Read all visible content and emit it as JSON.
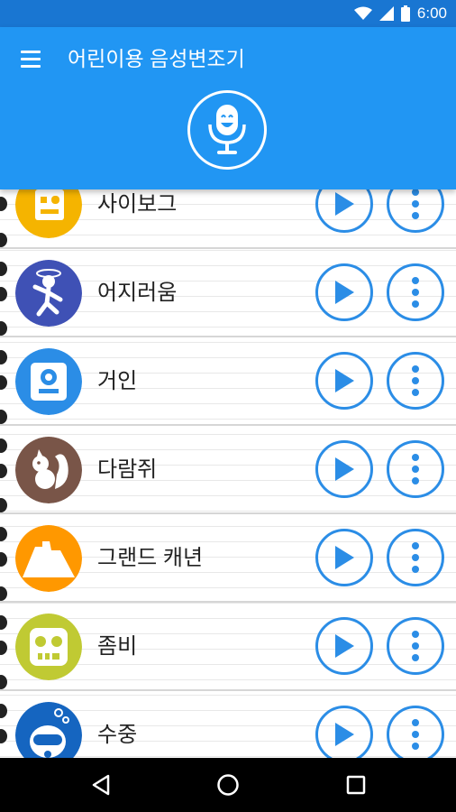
{
  "status_bar": {
    "time": "6:00"
  },
  "app_bar": {
    "title": "어린이용 음성변조기"
  },
  "voices": [
    {
      "label": "사이보그",
      "color": "#f5b400",
      "icon": "cyborg-icon"
    },
    {
      "label": "어지러움",
      "color": "#3f51b5",
      "icon": "dizzy-icon"
    },
    {
      "label": "거인",
      "color": "#2b8de6",
      "icon": "giant-icon"
    },
    {
      "label": "다람쥐",
      "color": "#795548",
      "icon": "squirrel-icon"
    },
    {
      "label": "그랜드 캐년",
      "color": "#ff9800",
      "icon": "grand-canyon-icon"
    },
    {
      "label": "좀비",
      "color": "#c0ca33",
      "icon": "zombie-icon"
    },
    {
      "label": "수중",
      "color": "#1565c0",
      "icon": "underwater-icon"
    }
  ],
  "colors": {
    "primary": "#2196f3",
    "primary_dark": "#1976d2",
    "accent": "#2b8de6"
  }
}
